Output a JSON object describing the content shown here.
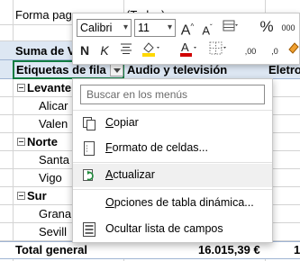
{
  "sheet": {
    "filter_row": {
      "label": "Forma pag",
      "value": "(Todas)"
    },
    "values_header": "Suma de V",
    "row_labels_header": "Etiquetas de fila",
    "col_header_1": "Audio y televisión",
    "col_header_2": "Eletro",
    "groups": [
      {
        "name": "Levante",
        "items": [
          "Alicar",
          "Valen"
        ]
      },
      {
        "name": "Norte",
        "items": [
          "Santa",
          "Vigo"
        ]
      },
      {
        "name": "Sur",
        "items": [
          "Grana",
          "Sevill"
        ]
      }
    ],
    "total_label": "Total general",
    "total_value": "16.015,39 €",
    "total_value_2": "1"
  },
  "mini_toolbar": {
    "font_name": "Calibri",
    "font_size": "11",
    "grow_font": "A",
    "shrink_font": "A",
    "bold": "N",
    "italic": "K",
    "percent": "%",
    "thousands": "000",
    "decimals_increase": ",00",
    "decimals_decrease": ",0"
  },
  "context_menu": {
    "search_placeholder": "Buscar en los menús",
    "items": [
      {
        "label": "Copiar",
        "icon": "copy-icon"
      },
      {
        "label": "Formato de celdas...",
        "icon": "format-cells-icon"
      },
      {
        "label": "Actualizar",
        "icon": "refresh-icon"
      },
      {
        "label": "Opciones de tabla dinámica...",
        "icon": ""
      },
      {
        "label": "Ocultar lista de campos",
        "icon": "field-list-icon"
      }
    ]
  },
  "colors": {
    "excel_green": "#107c41",
    "header_blue": "#dde7f3",
    "font_color_red": "#d00000",
    "highlight_yellow": "#ffd800"
  }
}
